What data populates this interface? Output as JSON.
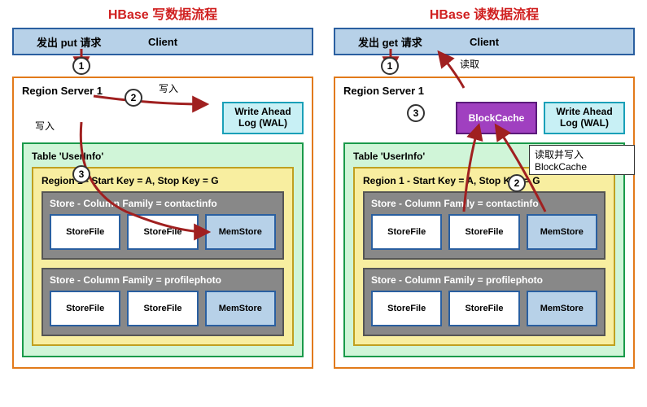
{
  "left": {
    "title": "HBase 写数据流程",
    "client_request": "发出 put 请求",
    "client_label": "Client",
    "rs_label": "Region Server 1",
    "wal_line1": "Write Ahead",
    "wal_line2": "Log (WAL)",
    "table_label": "Table 'UserInfo'",
    "region_label": "Region 1 - Start Key = A, Stop Key = G",
    "store1_label": "Store - Column Family = contactinfo",
    "store2_label": "Store - Column Family = profilephoto",
    "storefile_label": "StoreFile",
    "memstore_label": "MemStore",
    "step1": "1",
    "step2": "2",
    "step3": "3",
    "annot_write1": "写入",
    "annot_write2": "写入"
  },
  "right": {
    "title": "HBase 读数据流程",
    "client_request": "发出 get 请求",
    "client_label": "Client",
    "rs_label": "Region Server 1",
    "blockcache_label": "BlockCache",
    "wal_line1": "Write Ahead",
    "wal_line2": "Log (WAL)",
    "table_label": "Table 'UserInfo'",
    "region_label": "Region 1 - Start Key = A, Stop Key = G",
    "store1_label": "Store - Column Family = contactinfo",
    "store2_label": "Store - Column Family = profilephoto",
    "storefile_label": "StoreFile",
    "memstore_label": "MemStore",
    "step1": "1",
    "step2": "2",
    "step3": "3",
    "annot_read": "读取",
    "callout_text": "读取并写入 BlockCache"
  }
}
